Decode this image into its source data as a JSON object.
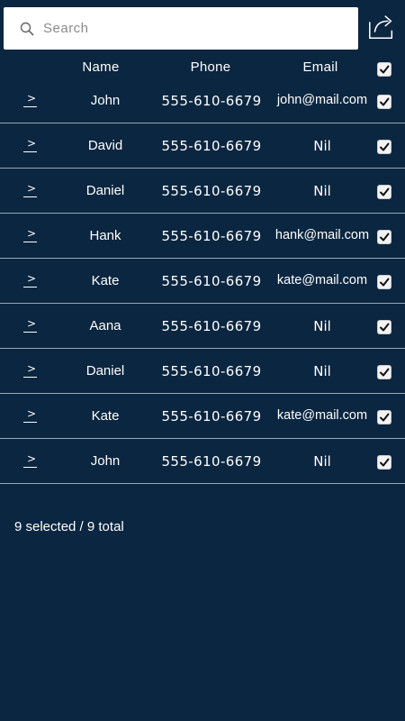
{
  "search": {
    "placeholder": "Search",
    "value": ""
  },
  "header": {
    "name_label": "Name",
    "phone_label": "Phone",
    "email_label": "Email",
    "select_all_checked": true
  },
  "rows": [
    {
      "name": "John",
      "phone": "555-610-6679",
      "email": "john@mail.com",
      "checked": true
    },
    {
      "name": "David",
      "phone": "555-610-6679",
      "email": "Nil",
      "checked": true
    },
    {
      "name": "Daniel",
      "phone": "555-610-6679",
      "email": "Nil",
      "checked": true
    },
    {
      "name": "Hank",
      "phone": "555-610-6679",
      "email": "hank@mail.com",
      "checked": true
    },
    {
      "name": "Kate",
      "phone": "555-610-6679",
      "email": "kate@mail.com",
      "checked": true
    },
    {
      "name": "Aana",
      "phone": "555-610-6679",
      "email": "Nil",
      "checked": true
    },
    {
      "name": "Daniel",
      "phone": "555-610-6679",
      "email": "Nil",
      "checked": true
    },
    {
      "name": "Kate",
      "phone": "555-610-6679",
      "email": "kate@mail.com",
      "checked": true
    },
    {
      "name": "John",
      "phone": "555-610-6679",
      "email": "Nil",
      "checked": true
    }
  ],
  "footer": {
    "selection_summary": "9 selected / 9 total"
  },
  "icons": {
    "search": "search-icon",
    "share": "share-icon",
    "expand": "chevron-right-icon",
    "checkbox": "checkmark-icon"
  },
  "colors": {
    "background": "#0b2640",
    "text": "#ffffff",
    "divider": "#9aa7b4",
    "search_bg": "#ffffff"
  }
}
